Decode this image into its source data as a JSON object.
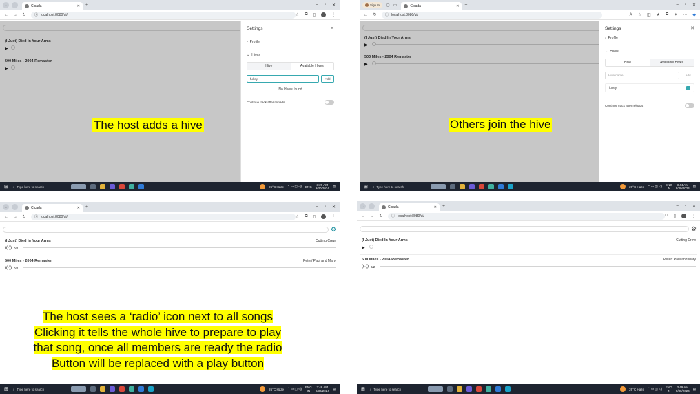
{
  "browser": {
    "tab_title": "Cicada",
    "url": "localhost:8080/ui/",
    "sign_in": "Sign In"
  },
  "tracks": [
    {
      "title": "(I Just) Died In Your Arms",
      "artist": "Cutting Crew",
      "ratio": "0/2"
    },
    {
      "title": "500 Miles - 2004 Remaster",
      "artist": "Peter/ Paul and Mary",
      "ratio": "0/2"
    }
  ],
  "settings": {
    "title": "Settings",
    "profile": "Profile",
    "hives": "Hives",
    "tab_hive": "Hive",
    "tab_available": "Available Hives",
    "hive_input_value": "fulrey",
    "hive_input_placeholder": "Hive name",
    "add": "Add",
    "no_hives": "No Hives found",
    "hive_item": "fulrey",
    "continue": "Continue track after reloads"
  },
  "taskbar": {
    "search": "Type here to search",
    "weather": "26°C Haze",
    "lang": "ENG",
    "region": "IN",
    "date": "9/30/2024",
    "time1": "3:29 AM",
    "time2": "3:44 AM",
    "time3": "3:46 AM",
    "time4": "3:49 AM"
  },
  "captions": {
    "q1": "The host adds a hive",
    "q2": "Others join the hive",
    "q3": [
      "The host sees a ‘radio’ icon next to all songs",
      "Clicking it tells the whole hive to prepare to play",
      "that song, once all members are ready the radio",
      "Button will be replaced with a play button"
    ]
  },
  "colors": {
    "caption_bg": "#ffff00",
    "accent": "#37a9b0",
    "taskbar": "#1e2430"
  }
}
